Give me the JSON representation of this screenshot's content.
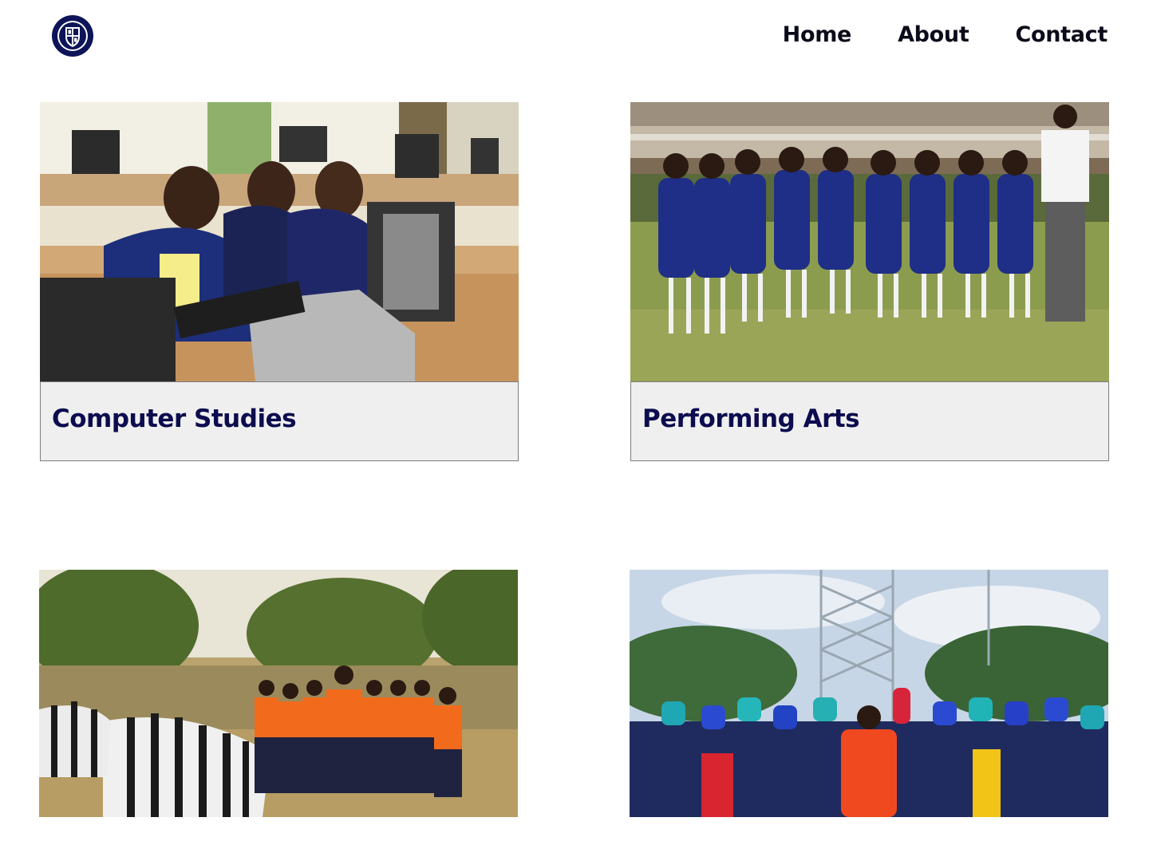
{
  "header": {
    "logo_icon": "school-crest-icon",
    "nav": [
      {
        "label": "Home"
      },
      {
        "label": "About"
      },
      {
        "label": "Contact"
      }
    ]
  },
  "cards": [
    {
      "title": "Computer Studies",
      "image": "students-at-computers-photo"
    },
    {
      "title": "Performing Arts",
      "image": "students-in-uniforms-photo"
    },
    {
      "title": "",
      "image": "students-with-zebras-photo"
    },
    {
      "title": "",
      "image": "students-with-bags-photo"
    }
  ],
  "colors": {
    "title": "#0c0c4f",
    "nav": "#0b0b1a",
    "caption_bg": "#efefef",
    "logo": "#0d1457"
  }
}
